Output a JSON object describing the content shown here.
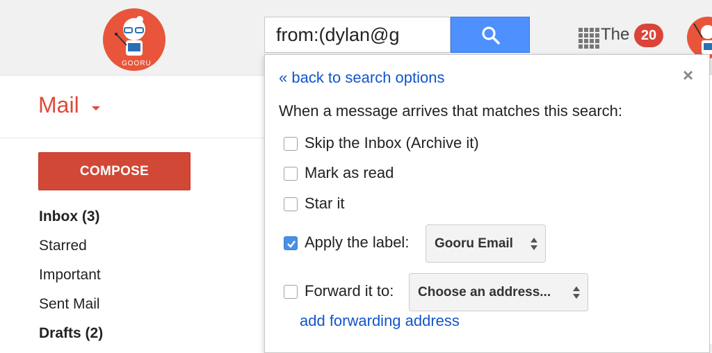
{
  "header": {
    "logo_text": "GOORU",
    "search_value": "from:(dylan@g",
    "account_name": "The",
    "notification_count": "20",
    "icons": {
      "search": "search-icon",
      "apps": "apps-grid-icon"
    },
    "colors": {
      "search_button": "#4d90fe",
      "badge": "#db4437"
    }
  },
  "sidebar": {
    "mail_label": "Mail",
    "compose_label": "COMPOSE",
    "items": [
      {
        "label": "Inbox (3)",
        "bold": true
      },
      {
        "label": "Starred",
        "bold": false
      },
      {
        "label": "Important",
        "bold": false
      },
      {
        "label": "Sent Mail",
        "bold": false
      },
      {
        "label": "Drafts (2)",
        "bold": true
      }
    ],
    "colors": {
      "compose": "#d14836",
      "mail_label": "#dd4b39"
    }
  },
  "filter_popup": {
    "back_link": "« back to search options",
    "close_label": "×",
    "heading": "When a message arrives that matches this search:",
    "options": [
      {
        "label": "Skip the Inbox (Archive it)",
        "checked": false
      },
      {
        "label": "Mark as read",
        "checked": false
      },
      {
        "label": "Star it",
        "checked": false
      },
      {
        "label": "Apply the label:",
        "checked": true
      },
      {
        "label": "Forward it to:",
        "checked": false
      }
    ],
    "label_select_value": "Gooru Email",
    "forward_select_value": "Choose an address...",
    "add_forwarding_link": "add forwarding address",
    "colors": {
      "link": "#1155cc",
      "checkbox_checked": "#4a90e2"
    }
  }
}
